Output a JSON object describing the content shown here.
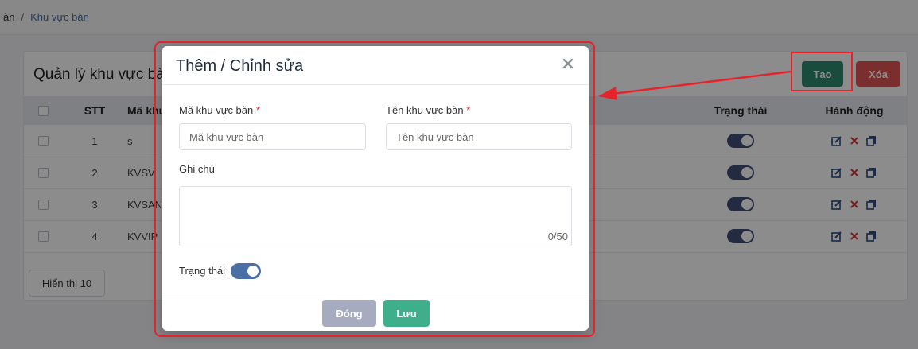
{
  "breadcrumb": {
    "prefix": "àn",
    "separator": "/",
    "current": "Khu vực bàn"
  },
  "card": {
    "title": "Quản lý khu vực bàn",
    "create_label": "Tạo",
    "delete_label": "Xóa",
    "columns": {
      "stt": "STT",
      "code": "Mã khu",
      "status": "Trạng thái",
      "action": "Hành động"
    },
    "rows": [
      {
        "stt": "1",
        "code": "s",
        "status_on": true
      },
      {
        "stt": "2",
        "code": "KVSV",
        "status_on": true
      },
      {
        "stt": "3",
        "code": "KVSAN",
        "status_on": true
      },
      {
        "stt": "4",
        "code": "KVVIP",
        "status_on": true
      }
    ],
    "page_size_label": "Hiển thị 10"
  },
  "modal": {
    "title": "Thêm / Chỉnh sửa",
    "close_icon": "close-icon",
    "code_label": "Mã khu vực bàn",
    "code_placeholder": "Mã khu vực bàn",
    "code_value": "",
    "name_label": "Tên khu vực bàn",
    "name_placeholder": "Tên khu vực bàn",
    "name_value": "",
    "required_mark": "*",
    "note_label": "Ghi chú",
    "note_value": "",
    "note_counter": "0/50",
    "status_label": "Trạng thái",
    "status_on": true,
    "close_button": "Đóng",
    "save_button": "Lưu"
  },
  "colors": {
    "create": "#2e8b6e",
    "delete": "#e05555",
    "toggle": "#3f4f73",
    "highlight": "#e8222a",
    "save": "#3fae8a",
    "close": "#a6abbf"
  }
}
